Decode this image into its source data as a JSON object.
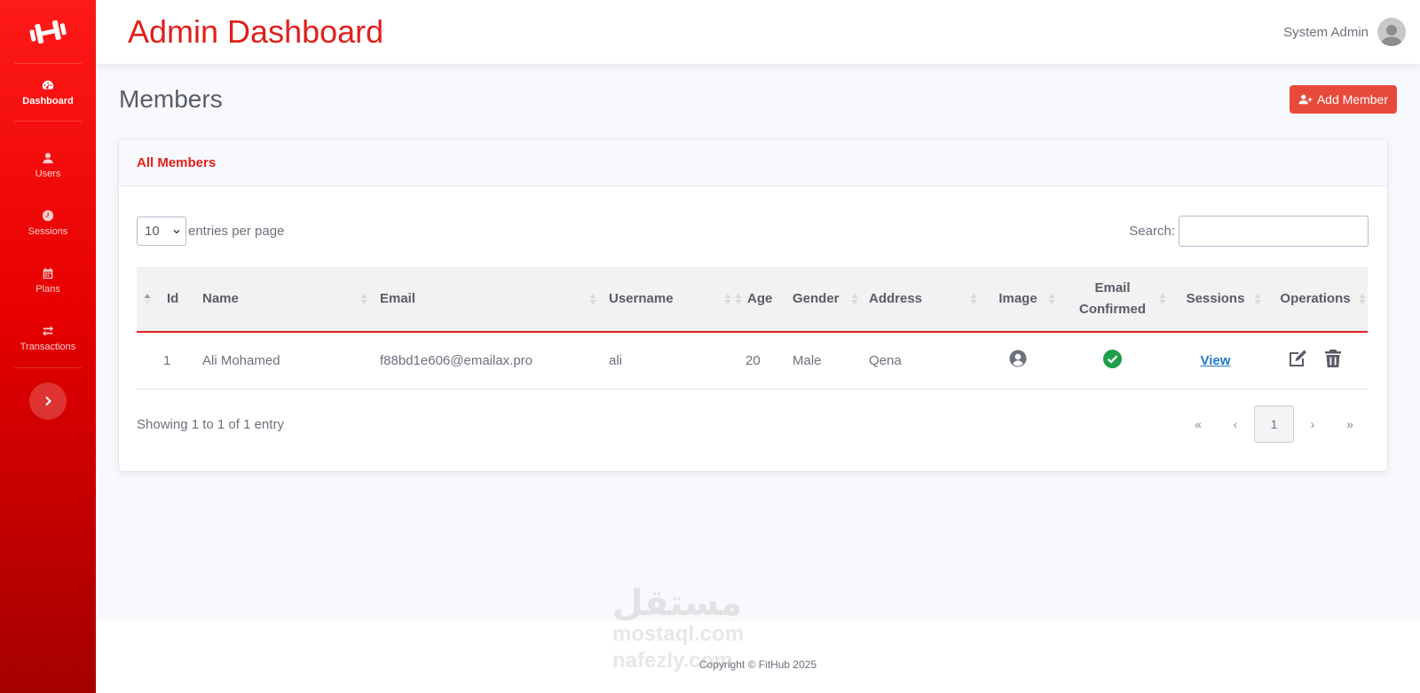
{
  "colors": {
    "accent": "#e0201d",
    "sidebar_top": "#ff1a1a",
    "sidebar_bottom": "#a50000",
    "success": "#1e9e4a",
    "link": "#1f7ac9"
  },
  "header": {
    "title": "Admin Dashboard",
    "user_name": "System Admin"
  },
  "sidebar": {
    "logo_icon": "dumbbell-icon",
    "items": [
      {
        "label": "Dashboard",
        "icon": "tachometer-icon",
        "active": true
      },
      {
        "label": "Users",
        "icon": "user-icon",
        "active": false
      },
      {
        "label": "Sessions",
        "icon": "clock-icon",
        "active": false
      },
      {
        "label": "Plans",
        "icon": "calendar-icon",
        "active": false
      },
      {
        "label": "Transactions",
        "icon": "exchange-icon",
        "active": false
      }
    ],
    "toggle_icon": "chevron-right-icon"
  },
  "main": {
    "heading": "Members",
    "add_button_label": "Add Member",
    "card_title": "All Members",
    "entries_select_value": "10",
    "entries_label": "entries per page",
    "search_label": "Search:",
    "search_value": "",
    "table": {
      "columns": [
        "Id",
        "Name",
        "Email",
        "Username",
        "Age",
        "Gender",
        "Address",
        "Image",
        "Email Confirmed",
        "Sessions",
        "Operations"
      ],
      "rows": [
        {
          "id": "1",
          "name": "Ali Mohamed",
          "email": "f88bd1e606@emailax.pro",
          "username": "ali",
          "age": "20",
          "gender": "Male",
          "address": "Qena",
          "image_icon": "user-circle-icon",
          "email_confirmed_icon": "check-circle-icon",
          "sessions_link": "View",
          "operations": [
            "edit-icon",
            "trash-icon"
          ]
        }
      ]
    },
    "showing_text": "Showing 1 to 1 of 1 entry",
    "pagination": {
      "first": "«",
      "prev": "‹",
      "current": "1",
      "next": "›",
      "last": "»"
    }
  },
  "footer": {
    "copyright": "Copyright © FitHub 2025"
  },
  "watermark": {
    "line1": "مستقل",
    "line2": "mostaql.com",
    "line3": "nafezly.com"
  }
}
